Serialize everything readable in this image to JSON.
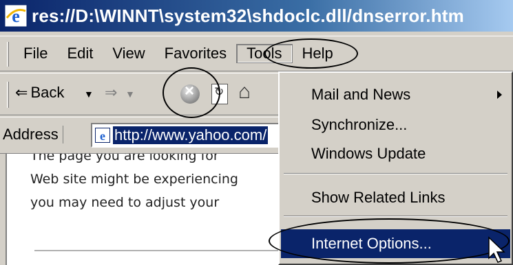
{
  "window": {
    "title": "res://D:\\WINNT\\system32\\shdoclc.dll/dnserror.htm",
    "icon": "ie-icon"
  },
  "menubar": {
    "items": [
      "File",
      "Edit",
      "View",
      "Favorites",
      "Tools",
      "Help"
    ],
    "active": "Tools"
  },
  "toolbar": {
    "back_label": "Back",
    "back_icon": "back-arrow-icon",
    "forward_icon": "forward-arrow-icon",
    "stop_icon": "stop-icon",
    "refresh_icon": "refresh-icon",
    "home_icon": "home-icon"
  },
  "addressbar": {
    "label": "Address",
    "value": "http://www.yahoo.com/"
  },
  "page": {
    "lines": [
      "The page you are looking for",
      "Web site might be experiencing",
      "you may need to adjust your"
    ]
  },
  "tools_menu": {
    "items": [
      {
        "label": "Mail and News",
        "submenu": true
      },
      {
        "label": "Synchronize..."
      },
      {
        "label": "Windows Update"
      },
      {
        "label": "Show Related Links"
      },
      {
        "label": "Internet Options...",
        "selected": true
      }
    ]
  },
  "colors": {
    "selection": "#0a246a",
    "face": "#d4d0c8"
  }
}
